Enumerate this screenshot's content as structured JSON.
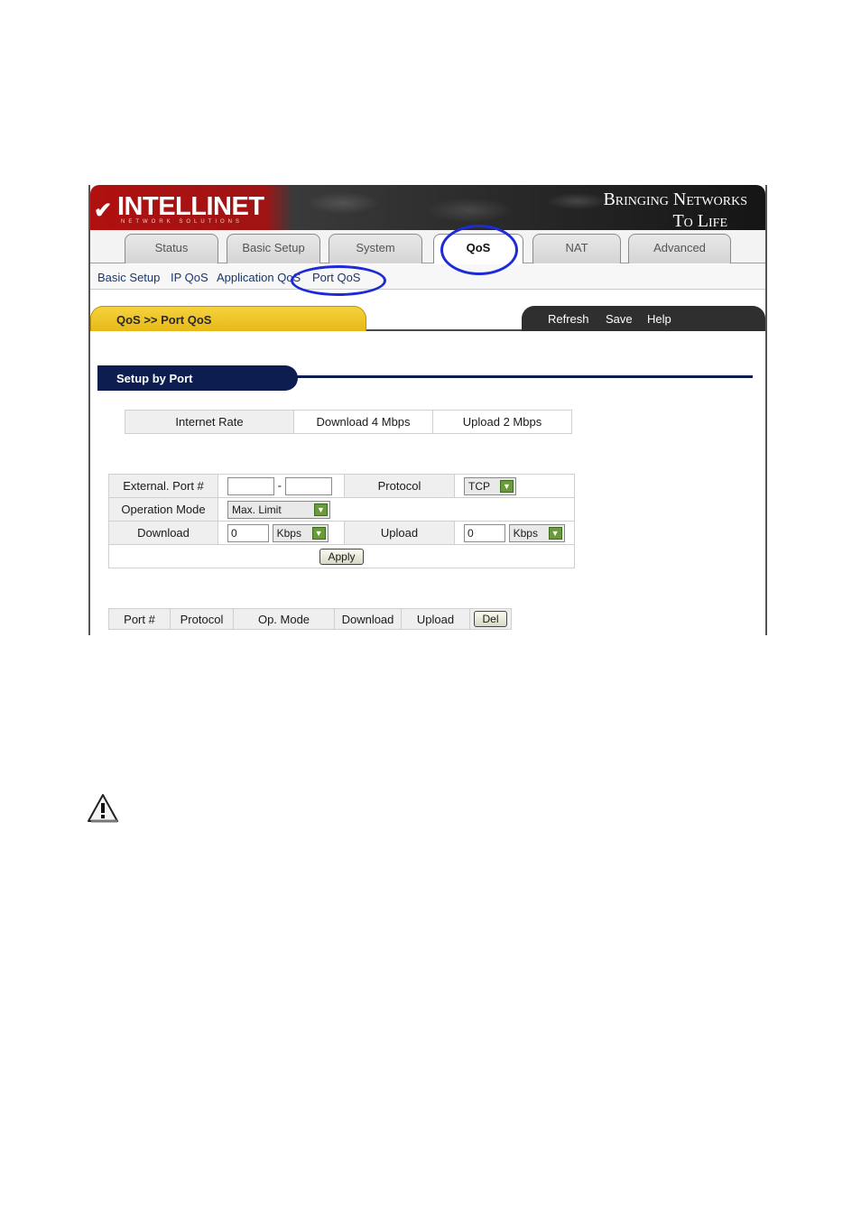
{
  "header": {
    "brand": "INTELLINET",
    "brand_sub": "NETWORK SOLUTIONS",
    "slogan_line1": "Bringing Networks",
    "slogan_line2": "To Life"
  },
  "tabs": {
    "status": "Status",
    "basic_setup": "Basic Setup",
    "system": "System",
    "qos": "QoS",
    "nat": "NAT",
    "advanced": "Advanced"
  },
  "submenu": {
    "basic_setup": "Basic Setup",
    "ip_qos": "IP QoS",
    "application_qos": "Application QoS",
    "port_qos": "Port QoS"
  },
  "page": {
    "title": "QoS >> Port QoS",
    "refresh": "Refresh",
    "save": "Save",
    "help": "Help",
    "section": "Setup by Port"
  },
  "rate": {
    "label": "Internet Rate",
    "download": "Download 4 Mbps",
    "upload": "Upload 2 Mbps"
  },
  "form": {
    "external_port_label": "External. Port #",
    "port_separator": "-",
    "port_from": "",
    "port_to": "",
    "protocol_label": "Protocol",
    "protocol_value": "TCP",
    "operation_mode_label": "Operation Mode",
    "operation_mode_value": "Max. Limit",
    "download_label": "Download",
    "download_value": "0",
    "download_unit": "Kbps",
    "upload_label": "Upload",
    "upload_value": "0",
    "upload_unit": "Kbps",
    "apply": "Apply"
  },
  "list": {
    "columns": [
      "Port #",
      "Protocol",
      "Op. Mode",
      "Download",
      "Upload"
    ],
    "del": "Del"
  },
  "colors": {
    "highlight_circle": "#1c2bd6",
    "title_tab": "#e8b919",
    "section_pill": "#0e1d4f"
  }
}
